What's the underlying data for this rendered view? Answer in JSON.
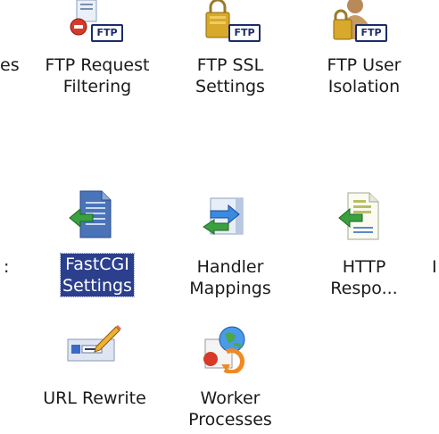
{
  "features": {
    "row1": [
      {
        "line1": "FTP Request",
        "line2": "Filtering",
        "badge": "FTP",
        "icon": "ftp-request-filtering-icon"
      },
      {
        "line1": "FTP SSL",
        "line2": "Settings",
        "badge": "FTP",
        "icon": "ftp-ssl-lock-icon"
      },
      {
        "line1": "FTP User",
        "line2": "Isolation",
        "badge": "FTP",
        "icon": "ftp-user-isolation-icon"
      }
    ],
    "row2": [
      {
        "line1": "FastCGI",
        "line2": "Settings",
        "selected": true,
        "icon": "fastcgi-document-icon"
      },
      {
        "line1": "Handler",
        "line2": "Mappings",
        "icon": "handler-mappings-icon"
      },
      {
        "line1": "HTTP",
        "line2": "Respo...",
        "icon": "http-response-document-icon"
      }
    ],
    "row3": [
      {
        "line1": "URL Rewrite",
        "line2": "",
        "icon": "url-rewrite-pencil-icon"
      },
      {
        "line1": "Worker",
        "line2": "Processes",
        "icon": "worker-processes-globe-icon"
      }
    ]
  },
  "clipped": {
    "row1_left": "es",
    "row2_left": ":",
    "row2_right": "I"
  }
}
